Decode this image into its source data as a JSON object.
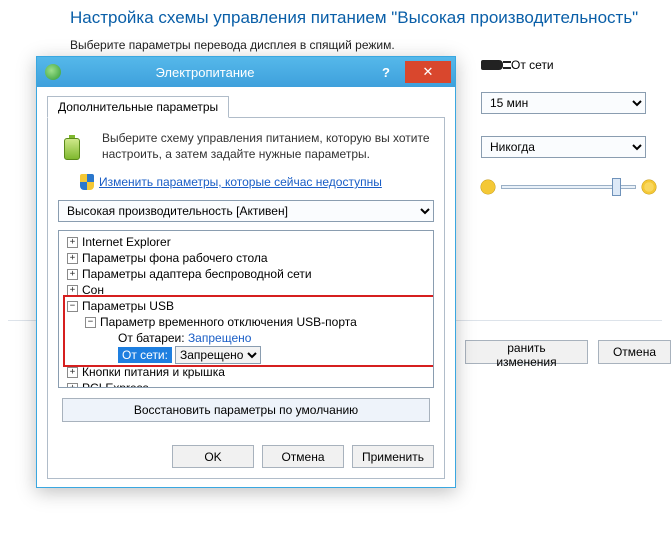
{
  "header": {
    "title": "Настройка схемы управления питанием \"Высокая производительность\"",
    "subtitle": "Выберите параметры перевода дисплея в спящий режим."
  },
  "right": {
    "source_label": "От сети",
    "select1": "15 мин",
    "select2": "Никогда"
  },
  "bg_buttons": {
    "save": "ранить изменения",
    "cancel": "Отмена"
  },
  "dialog": {
    "title": "Электропитание",
    "tab": "Дополнительные параметры",
    "description": "Выберите схему управления питанием, которую вы хотите настроить, а затем задайте нужные параметры.",
    "link": "Изменить параметры, которые сейчас недоступны",
    "plan": "Высокая производительность [Активен]",
    "tree": {
      "n1": "Internet Explorer",
      "n2": "Параметры фона рабочего стола",
      "n3": "Параметры адаптера беспроводной сети",
      "n4": "Сон",
      "n5": "Параметры USB",
      "n5_1": "Параметр временного отключения USB-порта",
      "n5_1_a_label": "От батареи:",
      "n5_1_a_value": "Запрещено",
      "n5_1_b_label": "От сети:",
      "n5_1_b_value": "Запрещено",
      "n6": "Кнопки питания и крышка",
      "n7": "PCI Express"
    },
    "restore": "Восстановить параметры по умолчанию",
    "ok": "OK",
    "cancel": "Отмена",
    "apply": "Применить"
  }
}
